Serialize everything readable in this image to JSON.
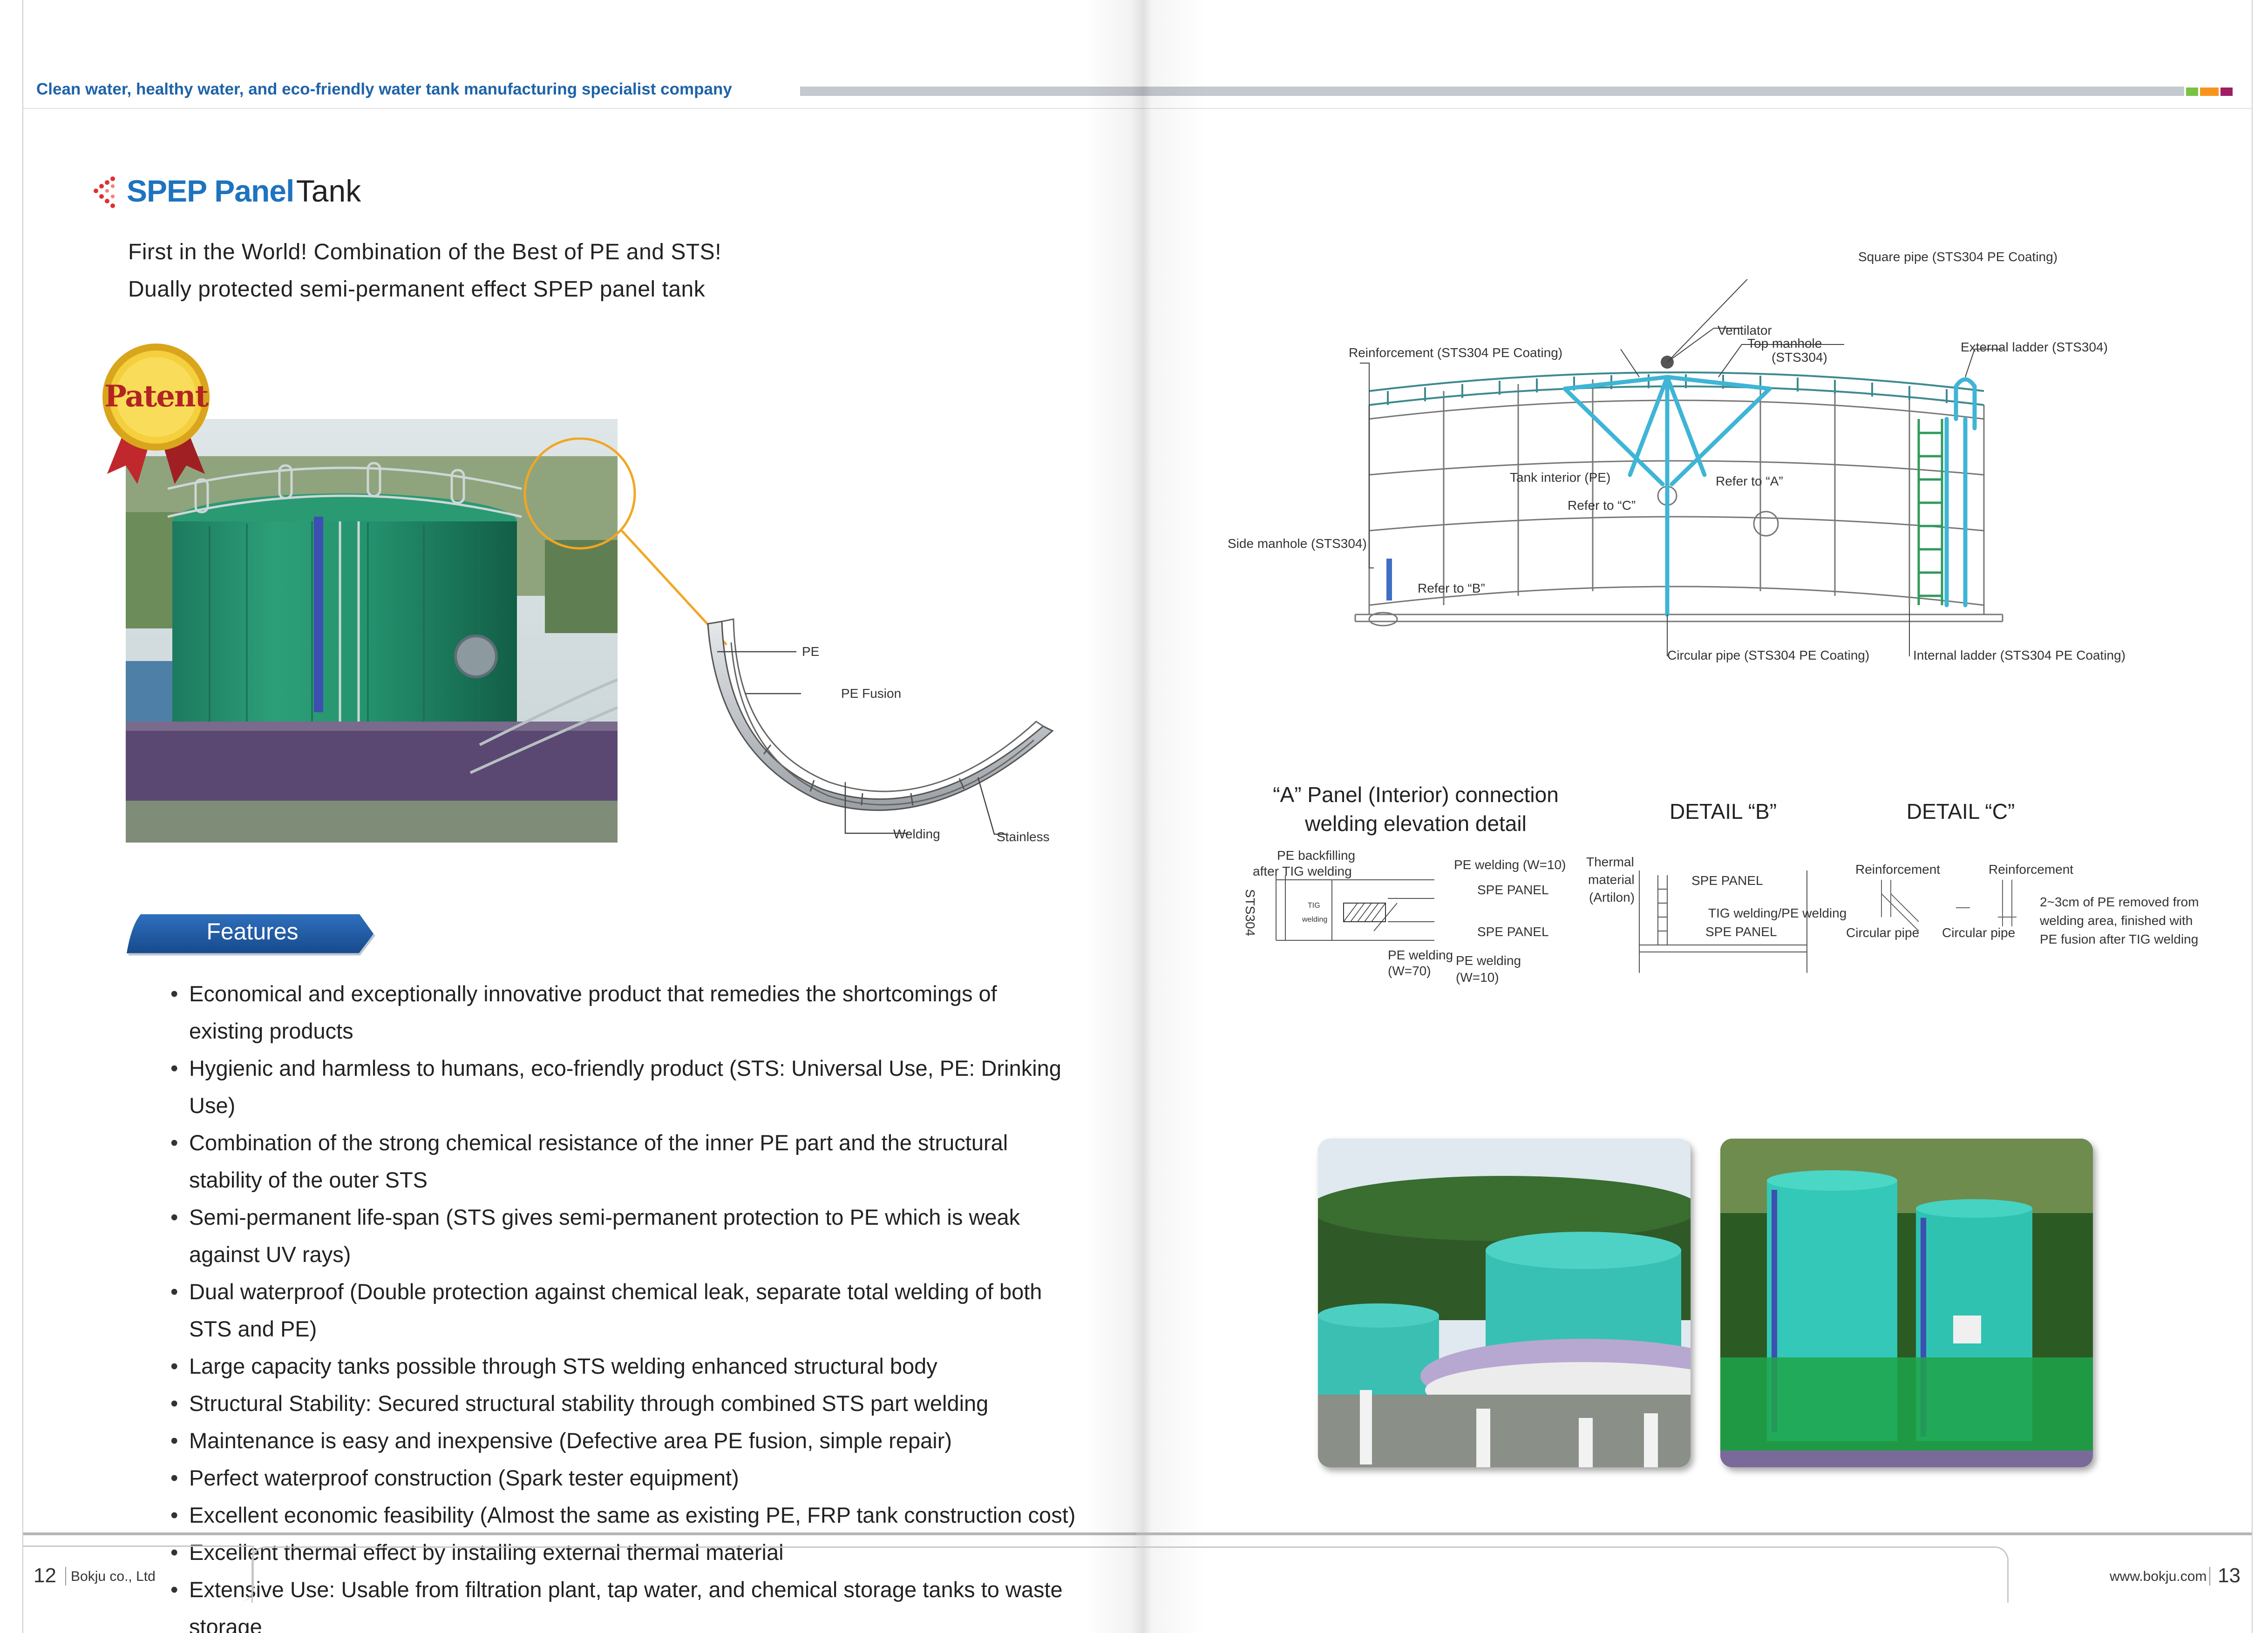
{
  "header": {
    "tagline": "Clean water, healthy water, and eco-friendly water tank manufacturing specialist company",
    "colors": [
      "#7bc143",
      "#f7941d",
      "#9e1f63"
    ]
  },
  "product": {
    "title_brand": "SPEP Panel",
    "title_suffix": "Tank",
    "subtitle_line1": "First in the World! Combination of the Best of PE and STS!",
    "subtitle_line2": "Dually protected semi-permanent effect SPEP panel tank",
    "badge": "Patent"
  },
  "cross_section": {
    "labels": {
      "pe": "PE",
      "pe_fusion": "PE Fusion",
      "welding": "Welding",
      "stainless": "Stainless"
    }
  },
  "features": {
    "title": "Features",
    "items": [
      "Economical and exceptionally innovative product that remedies the shortcomings of existing products",
      "Hygienic and harmless to humans, eco-friendly product (STS: Universal Use, PE: Drinking Use)",
      "Combination of the strong chemical resistance of the inner PE part and the structural stability of the outer STS",
      "Semi-permanent life-span (STS gives semi-permanent protection to PE which is weak against UV rays)",
      "Dual waterproof (Double protection against chemical leak, separate total welding of both STS and PE)",
      "Large capacity tanks possible through STS welding enhanced structural body",
      "Structural Stability: Secured structural stability through combined STS part welding",
      "Maintenance is easy and inexpensive (Defective area PE fusion, simple repair)",
      "Perfect waterproof construction (Spark tester equipment)",
      "Excellent economic feasibility (Almost the same as existing PE, FRP tank construction cost)",
      "Excellent thermal effect by installing external thermal material",
      "Extensive Use: Usable from filtration plant, tap water, and chemical storage tanks to waste storage"
    ]
  },
  "tank_diagram": {
    "labels": {
      "square_pipe": "Square pipe (STS304 PE Coating)",
      "ventilator": "Ventilator",
      "top_manhole_1": "Top manhole",
      "top_manhole_2": "(STS304)",
      "external_ladder": "External ladder (STS304)",
      "reinforcement": "Reinforcement (STS304 PE Coating)",
      "tank_interior": "Tank interior (PE)",
      "refer_a": "Refer to “A”",
      "refer_c": "Refer to “C”",
      "refer_b": "Refer to “B”",
      "side_manhole": "Side manhole (STS304)",
      "circular_pipe": "Circular pipe (STS304 PE Coating)",
      "internal_ladder": "Internal ladder (STS304 PE Coating)"
    }
  },
  "details": {
    "a_title_1": "“A” Panel (Interior) connection",
    "a_title_2": "welding elevation detail",
    "b_title": "DETAIL “B”",
    "c_title": "DETAIL “C”",
    "a_labels": {
      "pe_backfilling_1": "PE backfilling",
      "pe_backfilling_2": "after TIG welding",
      "pe_welding_w10_top": "PE welding (W=10)",
      "spe_panel_top": "SPE PANEL",
      "sts304": "STS304",
      "tig": "TIG",
      "welding": "welding",
      "spe_panel_bottom": "SPE PANEL",
      "pe_welding_w70_1": "PE welding",
      "pe_welding_w70_2": "(W=70)",
      "pe_welding_w10_1": "PE welding",
      "pe_welding_w10_2": "(W=10)"
    },
    "b_labels": {
      "thermal_1": "Thermal",
      "thermal_2": "material",
      "thermal_3": "(Artilon)",
      "spe_panel_top": "SPE PANEL",
      "tig_pe": "TIG welding/PE welding",
      "spe_panel_bottom": "SPE PANEL"
    },
    "c_labels": {
      "reinforcement_1": "Reinforcement",
      "reinforcement_2": "Reinforcement",
      "circular_pipe_1": "Circular pipe",
      "circular_pipe_2": "Circular pipe",
      "note_1": "2~3cm of PE removed from",
      "note_2": "welding area, finished with",
      "note_3": "PE fusion after TIG welding"
    }
  },
  "footer": {
    "left_page_number": "12",
    "company": "Bokju co., Ltd",
    "website": "www.bokju.com",
    "right_page_number": "13"
  }
}
